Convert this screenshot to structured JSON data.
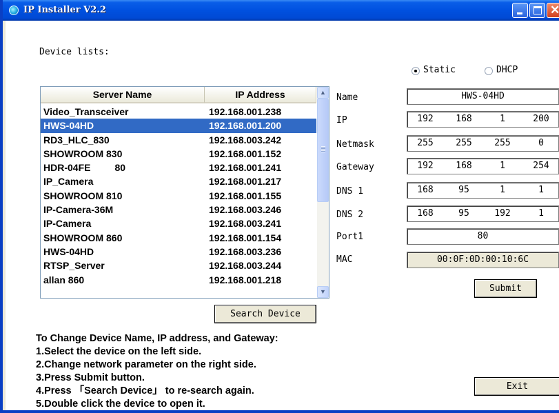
{
  "window": {
    "title": "IP Installer V2.2"
  },
  "device_list": {
    "label": "Device lists:",
    "columns": [
      "Server Name",
      "IP Address"
    ],
    "rows": [
      [
        "Video_Transceiver",
        "192.168.001.238"
      ],
      [
        "HWS-04HD",
        "192.168.001.200"
      ],
      [
        "RD3_HLC_830",
        "192.168.003.242"
      ],
      [
        "SHOWROOM 830",
        "192.168.001.152"
      ],
      [
        "HDR-04FE         80",
        "192.168.001.241"
      ],
      [
        "IP_Camera",
        "192.168.001.217"
      ],
      [
        "SHOWROOM 810",
        "192.168.001.155"
      ],
      [
        "IP-Camera-36M",
        "192.168.003.246"
      ],
      [
        "IP-Camera",
        "192.168.003.241"
      ],
      [
        "SHOWROOM 860",
        "192.168.001.154"
      ],
      [
        "HWS-04HD",
        "192.168.003.236"
      ],
      [
        "RTSP_Server",
        "192.168.003.244"
      ],
      [
        "allan 860",
        "192.168.001.218"
      ]
    ],
    "selected_index": 1
  },
  "buttons": {
    "search": "Search Device",
    "submit": "Submit",
    "exit": "Exit"
  },
  "mode": {
    "static_label": "Static",
    "dhcp_label": "DHCP",
    "selected": "Static"
  },
  "fields": {
    "name": {
      "label": "Name",
      "value": "HWS-04HD"
    },
    "ip": {
      "label": "IP",
      "octets": [
        "192",
        "168",
        "1",
        "200"
      ]
    },
    "netmask": {
      "label": "Netmask",
      "octets": [
        "255",
        "255",
        "255",
        "0"
      ]
    },
    "gateway": {
      "label": "Gateway",
      "octets": [
        "192",
        "168",
        "1",
        "254"
      ]
    },
    "dns1": {
      "label": "DNS 1",
      "octets": [
        "168",
        "95",
        "1",
        "1"
      ]
    },
    "dns2": {
      "label": "DNS 2",
      "octets": [
        "168",
        "95",
        "192",
        "1"
      ]
    },
    "port1": {
      "label": "Port1",
      "value": "80"
    },
    "mac": {
      "label": "MAC",
      "value": "00:0F:0D:00:10:6C"
    }
  },
  "instructions": [
    "To Change Device Name, IP address, and Gateway:",
    "1.Select the device on the left side.",
    "2.Change network parameter on the right side.",
    "3.Press Submit button.",
    "4.Press 「Search Device」 to re-search again.",
    "5.Double click the device to open it."
  ]
}
